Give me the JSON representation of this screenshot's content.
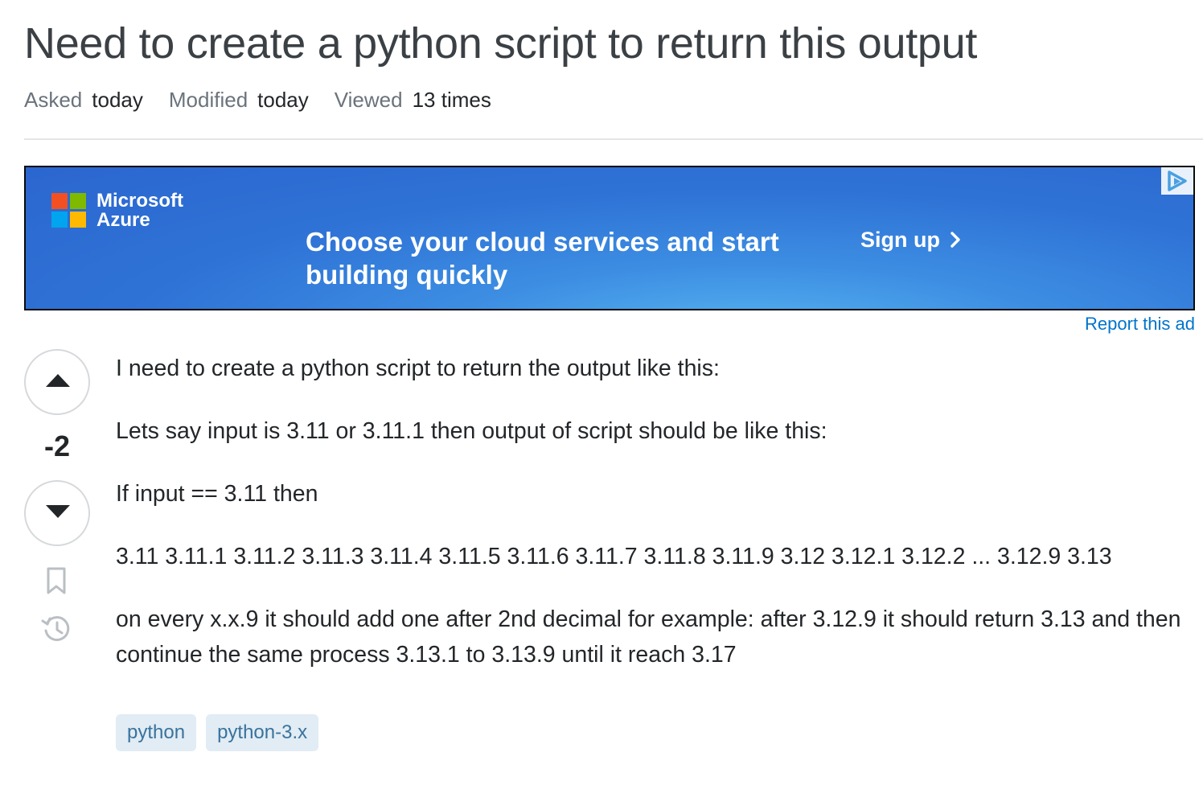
{
  "question": {
    "title": "Need to create a python script to return this output",
    "meta": {
      "asked_label": "Asked",
      "asked_value": "today",
      "modified_label": "Modified",
      "modified_value": "today",
      "viewed_label": "Viewed",
      "viewed_value": "13 times"
    }
  },
  "ad": {
    "brand_line1": "Microsoft",
    "brand_line2": "Azure",
    "headline_line1": "Choose your cloud services and start",
    "headline_line2": "building quickly",
    "cta": "Sign up",
    "cta_icon": "chevron-right-icon",
    "choices_icon": "adchoices-icon",
    "report_label": "Report this ad",
    "colors": {
      "background": "#2f73d6",
      "logo_red": "#f25022",
      "logo_green": "#7fba00",
      "logo_blue": "#00a4ef",
      "logo_yellow": "#ffb900"
    }
  },
  "vote": {
    "score": "-2",
    "upvote_icon": "upvote-arrow-icon",
    "downvote_icon": "downvote-arrow-icon",
    "bookmark_icon": "bookmark-icon",
    "history_icon": "history-icon"
  },
  "post": {
    "paragraphs": [
      "I need to create a python script to return the output like this:",
      "Lets say input is 3.11 or 3.11.1 then output of script should be like this:",
      "If input == 3.11 then",
      "3.11 3.11.1 3.11.2 3.11.3 3.11.4 3.11.5 3.11.6 3.11.7 3.11.8 3.11.9 3.12 3.12.1 3.12.2 ... 3.12.9 3.13",
      "on every x.x.9 it should add one after 2nd decimal for example: after 3.12.9 it should return 3.13 and then continue the same process 3.13.1 to 3.13.9 until it reach 3.17"
    ],
    "tags": [
      "python",
      "python-3.x"
    ]
  },
  "colors": {
    "link": "#0074cc",
    "tag_bg": "#e1ecf4",
    "tag_text": "#39739d",
    "muted": "#6a737c"
  }
}
